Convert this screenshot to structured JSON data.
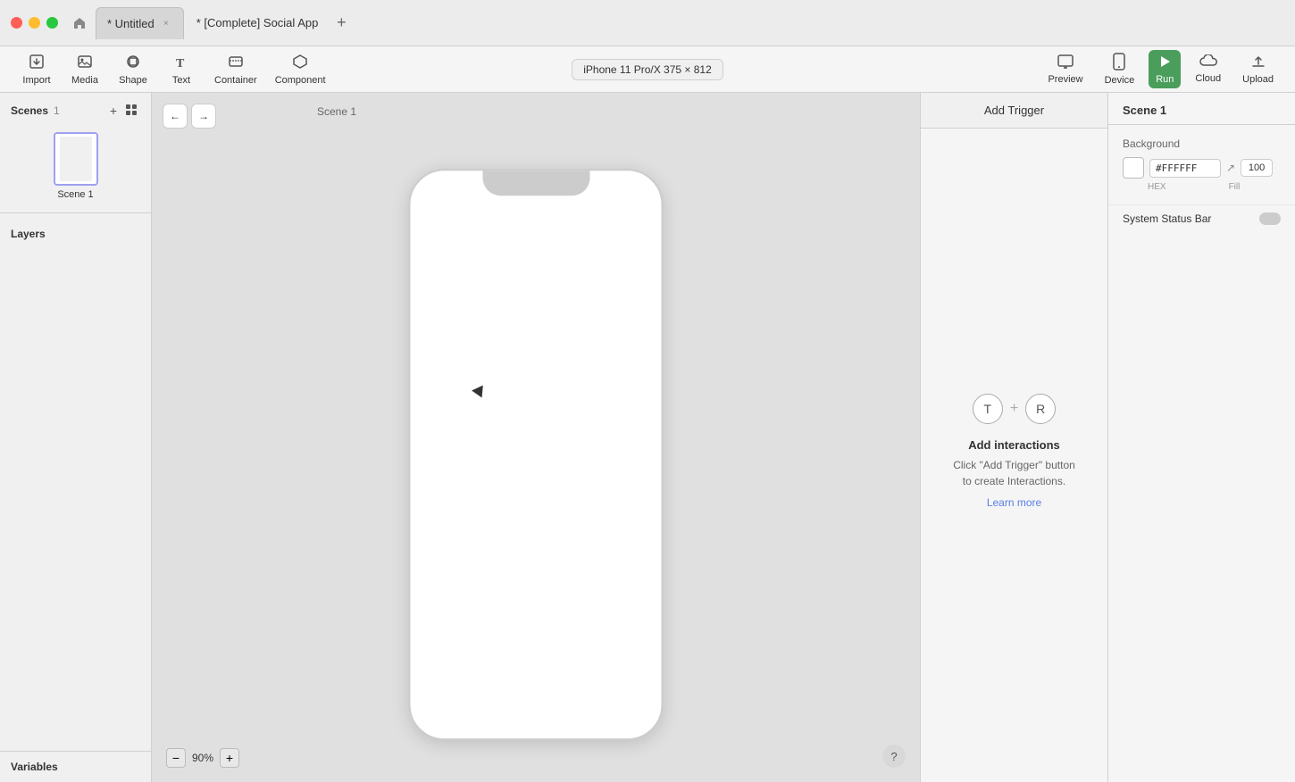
{
  "titlebar": {
    "tabs": [
      {
        "label": "* Untitled",
        "active": true,
        "closable": true
      },
      {
        "label": "* [Complete] Social App",
        "active": false,
        "closable": false
      }
    ],
    "add_tab_label": "+"
  },
  "toolbar": {
    "import_label": "Import",
    "media_label": "Media",
    "shape_label": "Shape",
    "text_label": "Text",
    "container_label": "Container",
    "component_label": "Component",
    "device_label": "iPhone 11 Pro/X  375 × 812",
    "preview_label": "Preview",
    "device_btn_label": "Device",
    "run_label": "Run",
    "cloud_label": "Cloud",
    "upload_label": "Upload"
  },
  "sidebar": {
    "scenes_label": "Scenes",
    "scenes_count": "1",
    "scene_name": "Scene 1",
    "layers_label": "Layers",
    "variables_label": "Variables"
  },
  "canvas": {
    "scene_label": "Scene 1",
    "zoom_value": "90%",
    "zoom_minus": "−",
    "zoom_plus": "+"
  },
  "trigger_panel": {
    "header": "Add Trigger",
    "interactions_title": "Add interactions",
    "interactions_desc": "Click \"Add Trigger\" button\nto create Interactions.",
    "learn_more": "Learn more",
    "t_label": "T",
    "r_label": "R"
  },
  "properties_panel": {
    "scene_title": "Scene 1",
    "background_label": "Background",
    "hex_value": "#FFFFFF",
    "fill_value": "100",
    "hex_label": "HEX",
    "fill_label": "Fill",
    "system_status_label": "System Status Bar"
  }
}
